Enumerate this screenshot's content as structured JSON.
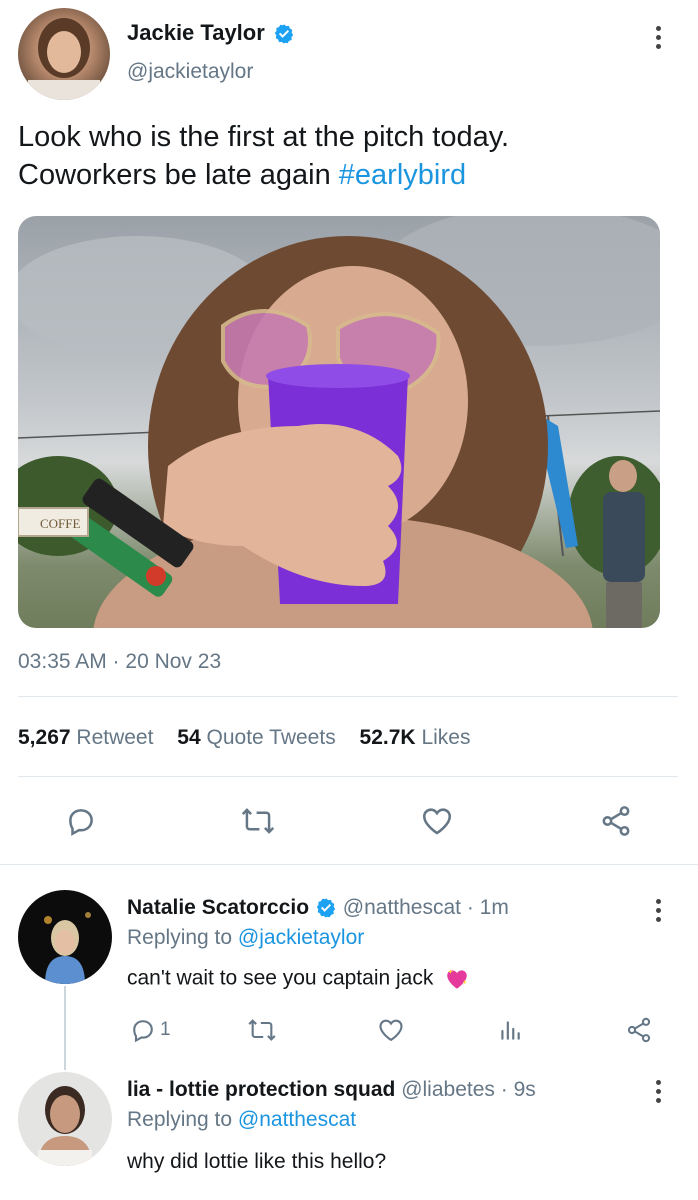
{
  "tweet": {
    "author_name": "Jackie Taylor",
    "handle": "@jackietaylor",
    "text_line1": "Look who is the first at the pitch today.",
    "text_line2_prefix": "Coworkers be late again ",
    "hashtag": "#earlybird",
    "image_sign_text": "COFFE",
    "timestamp": "03:35 AM · 20 Nov 23",
    "retweet_count": "5,267",
    "retweet_label": "Retweet",
    "quote_count": "54",
    "quote_label": "Quote Tweets",
    "like_count": "52.7K",
    "like_label": "Likes"
  },
  "replies": [
    {
      "author_name": "Natalie Scatorccio",
      "handle": "@natthescat",
      "time": "· 1m",
      "replying_prefix": "Replying to ",
      "replying_handle": "@jackietaylor",
      "text": "can't wait to see you captain jack",
      "reply_count": "1"
    },
    {
      "author_name": "lia - lottie protection squad",
      "handle": "@liabetes",
      "time": "· 9s",
      "replying_prefix": "Replying to ",
      "replying_handle": "@natthescat",
      "text": "why did lottie like this hello?"
    }
  ],
  "colors": {
    "link_blue": "#1b95e0",
    "verified_blue": "#1da1f2",
    "secondary_text": "#657786",
    "divider": "#e1e8ed",
    "cup_purple": "#7b2fd6"
  }
}
